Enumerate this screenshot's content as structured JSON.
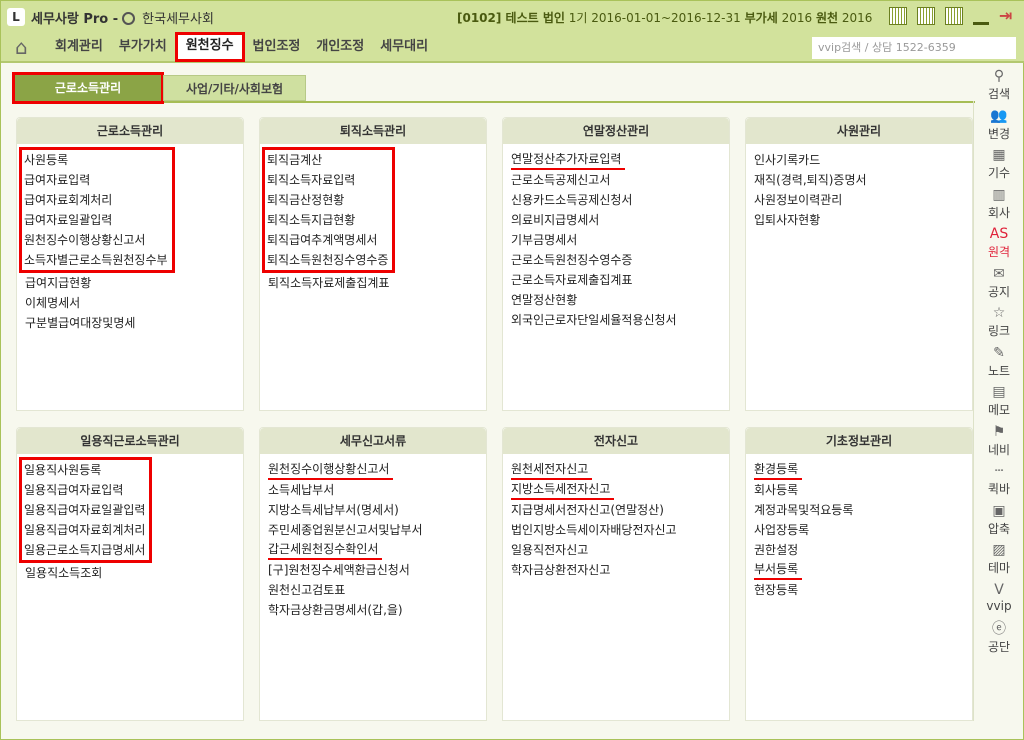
{
  "title": {
    "logo": "L",
    "app": "세무사랑 Pro -",
    "org": "한국세무사회",
    "company": "[0102] 테스트 법인",
    "period": "1기 2016-01-01~2016-12-31",
    "vat_label": "부가세",
    "vat_year": "2016",
    "wh_label": "원천",
    "wh_year": "2016"
  },
  "window_icons": [
    "calendar-grid-icon",
    "grid-icon",
    "layout-icon",
    "minimize-icon",
    "exit-icon"
  ],
  "menu": {
    "home": "⌂",
    "items": [
      "회계관리",
      "부가가치",
      "원천징수",
      "법인조정",
      "개인조정",
      "세무대리"
    ],
    "active": 2,
    "search_placeholder": "vvip검색 / 상담 1522-6359"
  },
  "subtabs": [
    "근로소득관리",
    "사업/기타/사회보험"
  ],
  "accent": "#8ba446",
  "highlight": "#ee0000",
  "panels": [
    {
      "title": "근로소득관리",
      "items": [
        "사원등록",
        "급여자료입력",
        "급여자료회계처리",
        "급여자료일괄입력",
        "원천징수이행상황신고서",
        "소득자별근로소득원천징수부",
        "급여지급현황",
        "이체명세서",
        "구분별급여대장및명세"
      ],
      "boxed": [
        0,
        1,
        2,
        3,
        4,
        5
      ],
      "underlined": []
    },
    {
      "title": "퇴직소득관리",
      "items": [
        "퇴직금계산",
        "퇴직소득자료입력",
        "퇴직금산정현황",
        "퇴직소득지급현황",
        "퇴직급여추계액명세서",
        "퇴직소득원천징수영수증",
        "퇴직소득자료제출집계표"
      ],
      "boxed": [
        0,
        1,
        2,
        3,
        4,
        5
      ],
      "underlined": []
    },
    {
      "title": "연말정산관리",
      "items": [
        "연말정산추가자료입력",
        "근로소득공제신고서",
        "신용카드소득공제신청서",
        "의료비지급명세서",
        "기부금명세서",
        "근로소득원천징수영수증",
        "근로소득자료제출집계표",
        "연말정산현황",
        "외국인근로자단일세율적용신청서"
      ],
      "boxed": [],
      "underlined": [
        0
      ]
    },
    {
      "title": "사원관리",
      "items": [
        "인사기록카드",
        "재직(경력,퇴직)증명서",
        "사원정보이력관리",
        "입퇴사자현황"
      ],
      "boxed": [],
      "underlined": []
    },
    {
      "title": "일용직근로소득관리",
      "items": [
        "일용직사원등록",
        "일용직급여자료입력",
        "일용직급여자료일괄입력",
        "일용직급여자료회계처리",
        "일용근로소득지급명세서",
        "일용직소득조회"
      ],
      "boxed": [
        0,
        1,
        2,
        3,
        4
      ],
      "underlined": []
    },
    {
      "title": "세무신고서류",
      "items": [
        "원천징수이행상황신고서",
        "소득세납부서",
        "지방소득세납부서(명세서)",
        "주민세종업원분신고서및납부서",
        "갑근세원천징수확인서",
        "[구]원천징수세액환급신청서",
        "원천신고검토표",
        "학자금상환금명세서(갑,을)"
      ],
      "boxed": [],
      "underlined": [
        0,
        4
      ]
    },
    {
      "title": "전자신고",
      "items": [
        "원천세전자신고",
        "지방소득세전자신고",
        "지급명세서전자신고(연말정산)",
        "법인지방소득세이자배당전자신고",
        "일용직전자신고",
        "학자금상환전자신고"
      ],
      "boxed": [],
      "underlined": [
        0,
        1
      ]
    },
    {
      "title": "기초정보관리",
      "items": [
        "환경등록",
        "회사등록",
        "계정과목및적요등록",
        "사업장등록",
        "권한설정",
        "부서등록",
        "현장등록"
      ],
      "boxed": [],
      "underlined": [
        0,
        5
      ]
    }
  ],
  "sidebar": [
    {
      "label": "검색",
      "icon": "search-icon",
      "glyph": "⚲"
    },
    {
      "label": "변경",
      "icon": "users-icon",
      "glyph": "👥"
    },
    {
      "label": "기수",
      "icon": "calendar-icon",
      "glyph": "▦"
    },
    {
      "label": "회사",
      "icon": "building-icon",
      "glyph": "▥"
    },
    {
      "label": "원격",
      "icon": "remote-as-icon",
      "glyph": "AS",
      "red": true
    },
    {
      "label": "공지",
      "icon": "notice-icon",
      "glyph": "✉"
    },
    {
      "label": "링크",
      "icon": "star-icon",
      "glyph": "☆"
    },
    {
      "label": "노트",
      "icon": "note-pin-icon",
      "glyph": "✎"
    },
    {
      "label": "메모",
      "icon": "memo-icon",
      "glyph": "▤"
    },
    {
      "label": "네비",
      "icon": "navi-icon",
      "glyph": "⚑"
    },
    {
      "label": "퀵바",
      "icon": "quickbar-icon",
      "glyph": "┄"
    },
    {
      "label": "압축",
      "icon": "compress-icon",
      "glyph": "▣"
    },
    {
      "label": "테마",
      "icon": "theme-image-icon",
      "glyph": "▨"
    },
    {
      "label": "vvip",
      "icon": "vvip-icon",
      "glyph": "V"
    },
    {
      "label": "공단",
      "icon": "e-icon",
      "glyph": "ⓔ"
    }
  ]
}
